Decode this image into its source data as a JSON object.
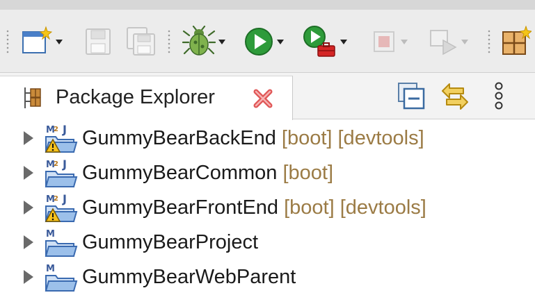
{
  "colors": {
    "decoration": "#9b7b45",
    "text": "#1a1a1a",
    "toolbar_bg": "#ececec"
  },
  "toolbar": {
    "buttons": [
      {
        "name": "new-wizard",
        "icon": "new-wizard-icon",
        "enabled": true,
        "dropdown": true
      },
      {
        "name": "save",
        "icon": "save-icon",
        "enabled": false
      },
      {
        "name": "save-all",
        "icon": "save-all-icon",
        "enabled": false
      },
      {
        "name": "debug",
        "icon": "bug-icon",
        "enabled": true,
        "dropdown": true
      },
      {
        "name": "run",
        "icon": "run-icon",
        "enabled": true,
        "dropdown": true
      },
      {
        "name": "run-external-tools",
        "icon": "external-tools-icon",
        "enabled": true,
        "dropdown": true
      },
      {
        "name": "stop",
        "icon": "stop-icon",
        "enabled": false,
        "dropdown": true
      },
      {
        "name": "next-annotation",
        "icon": "next-icon",
        "enabled": false,
        "dropdown": true
      },
      {
        "name": "perspective",
        "icon": "perspective-icon",
        "enabled": true
      }
    ]
  },
  "view": {
    "tab_title": "Package Explorer",
    "actions": [
      "collapse-all-icon",
      "link-with-editor-icon",
      "view-menu-icon"
    ]
  },
  "tree": {
    "items": [
      {
        "name": "GummyBearBackEnd",
        "decorations": "[boot] [devtools]",
        "warning": true,
        "maven": true
      },
      {
        "name": "GummyBearCommon",
        "decorations": "[boot]",
        "warning": false,
        "maven": true
      },
      {
        "name": "GummyBearFrontEnd",
        "decorations": "[boot] [devtools]",
        "warning": true,
        "maven": true
      },
      {
        "name": "GummyBearProject",
        "decorations": "",
        "warning": false,
        "maven": true
      },
      {
        "name": "GummyBearWebParent",
        "decorations": "",
        "warning": false,
        "maven": true
      }
    ]
  }
}
